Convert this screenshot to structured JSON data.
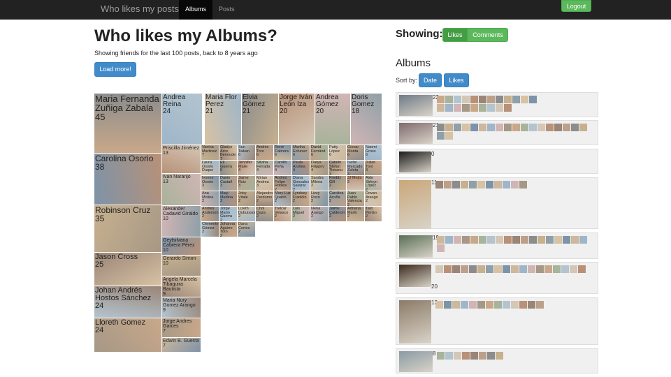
{
  "navbar": {
    "brand": "Who likes my posts?",
    "items": [
      {
        "label": "Albums",
        "active": true
      },
      {
        "label": "Posts",
        "active": false
      }
    ],
    "logout_label": "Logout"
  },
  "main": {
    "title": "Who likes my Albums?",
    "subtitle": "Showing friends for the last 100 posts, back to 8 years ago",
    "load_more_label": "Load more!"
  },
  "friends_mosaic": {
    "large": [
      {
        "name": "Maria Fernanda Zuñiga Zabala",
        "count": "45"
      },
      {
        "name": "Andrea Reina",
        "count": "24"
      },
      {
        "name": "Maria Flor Perez",
        "count": "21"
      },
      {
        "name": "Elvia Gómez",
        "count": "21"
      },
      {
        "name": "Jorge Iván León Iza",
        "count": "20"
      },
      {
        "name": "Andrea Gómez",
        "count": "20"
      },
      {
        "name": "Doris Gomez",
        "count": "18"
      },
      {
        "name": "Carolina Osorio",
        "count": "38"
      },
      {
        "name": "Robinson Cruz",
        "count": "35"
      },
      {
        "name": "Jason Cross",
        "count": "25"
      },
      {
        "name": "Johan Andrés Hostos Sánchez",
        "count": "24"
      },
      {
        "name": "Lloreth Gomez",
        "count": "24"
      }
    ],
    "medium": [
      {
        "name": "Priscilla Jiménez",
        "count": "13"
      },
      {
        "name": "Ivan Naranjo",
        "count": "13"
      },
      {
        "name": "Alexander Cadavid Giraldo",
        "count": "10"
      },
      {
        "name": "Geylsilvana Cabrera Pérez",
        "count": "10"
      },
      {
        "name": "Gerardo Simon",
        "count": "10"
      },
      {
        "name": "Angela Marcela Tibaquira Bautista",
        "count": "9"
      },
      {
        "name": "Maria Nury Gomez Arango",
        "count": "9"
      },
      {
        "name": "Jorge Andres Garces",
        "count": "7"
      },
      {
        "name": "Edwin B. Guerra",
        "count": "7"
      }
    ],
    "small": [
      {
        "name": "Vanina Martinez",
        "count": "7"
      },
      {
        "name": "Gladys Arce Bermude",
        "count": "7"
      },
      {
        "name": "Sun Taikan",
        "count": "6"
      },
      {
        "name": "Andrés Toro",
        "count": "6"
      },
      {
        "name": "René Cabrera",
        "count": "6"
      },
      {
        "name": "Martha Echever",
        "count": "6"
      },
      {
        "name": "David Fernánd",
        "count": "6"
      },
      {
        "name": "Patty López",
        "count": "6"
      },
      {
        "name": "Giovar Monta",
        "count": "6"
      },
      {
        "name": "Naomi Gross",
        "count": "6"
      },
      {
        "name": "Laura Osorio Duque",
        "count": ""
      },
      {
        "name": "Eli Guerra",
        "count": "5"
      },
      {
        "name": "Jennifer Maile",
        "count": "4"
      },
      {
        "name": "Silvina Ferrada",
        "count": "4"
      },
      {
        "name": "Carolin Peña",
        "count": "4"
      },
      {
        "name": "Paula Andrea",
        "count": "4"
      },
      {
        "name": "Darya Filippov",
        "count": "4"
      },
      {
        "name": "Catalin Stefan Tiseanu",
        "count": "3"
      },
      {
        "name": "Ivette Mercado Zuleta",
        "count": "3"
      },
      {
        "name": "Julian Toro",
        "count": "3"
      },
      {
        "name": "Ivonne Osorio",
        "count": "3"
      },
      {
        "name": "Danie Castañ",
        "count": "3"
      },
      {
        "name": "Jaime Ruiz",
        "count": "3"
      },
      {
        "name": "Mirian Andrea",
        "count": "3"
      },
      {
        "name": "Andres Felipe Robles",
        "count": "2"
      },
      {
        "name": "Diana Gonzalez Salazar",
        "count": "2"
      },
      {
        "name": "Sandra Milena",
        "count": "2"
      },
      {
        "name": "Freddy Gill",
        "count": "2"
      },
      {
        "name": "JJ Mejía",
        "count": "2"
      },
      {
        "name": "Aide Sirleyn López",
        "count": "2"
      },
      {
        "name": "Ana Molina",
        "count": "2"
      },
      {
        "name": "Mayi Medina",
        "count": "2"
      },
      {
        "name": "Joby Vitale",
        "count": "2"
      },
      {
        "name": "Alejandro Perdomo",
        "count": "2"
      },
      {
        "name": "Mary Luz Quarin",
        "count": "2"
      },
      {
        "name": "Lyndsey Franklin",
        "count": "2"
      },
      {
        "name": "Lizzy Rozo",
        "count": "2"
      },
      {
        "name": "Carolina Acuña",
        "count": "2"
      },
      {
        "name": "Juan Pablo Valencia",
        "count": "2"
      },
      {
        "name": "Dovan Arango",
        "count": "2"
      },
      {
        "name": "Andres Anderson",
        "count": "2"
      },
      {
        "name": "Jorge Mario Guerra",
        "count": "2"
      },
      {
        "name": "Lizeth Dubuisson",
        "count": "2"
      },
      {
        "name": "Chol Daza",
        "count": "2"
      },
      {
        "name": "Trelcar Velasco",
        "count": "2"
      },
      {
        "name": "Luis Miguel",
        "count": "2"
      },
      {
        "name": "Nena Arango",
        "count": "2"
      },
      {
        "name": "Jaime Calderon",
        "count": "2"
      },
      {
        "name": "Adriana Marín",
        "count": "2"
      },
      {
        "name": "Tato PerGo",
        "count": "2"
      },
      {
        "name": "Clemente Gómez",
        "count": "2"
      },
      {
        "name": "Johanna Aguirre Toro",
        "count": "2"
      },
      {
        "name": "Dana Cortes",
        "count": "2"
      }
    ]
  },
  "right": {
    "showing_label": "Showing:",
    "toggle": [
      {
        "label": "Likes",
        "active": true
      },
      {
        "label": "Comments",
        "active": false
      }
    ],
    "albums_heading": "Albums",
    "sort_label": "Sort by:",
    "sort_buttons": [
      {
        "label": "Date"
      },
      {
        "label": "Likes"
      }
    ],
    "albums": [
      {
        "count": "22",
        "likers": 21
      },
      {
        "count": "21",
        "likers": 20
      },
      {
        "count": "0",
        "likers": 0
      },
      {
        "count": "11",
        "likers": 11
      },
      {
        "count": "19",
        "likers": 19
      },
      {
        "count": "20",
        "likers": 18
      },
      {
        "count": "13",
        "likers": 13
      },
      {
        "count": "8",
        "likers": 8
      }
    ]
  },
  "colors": {
    "navbar": "#222222",
    "primary": "#428bca",
    "success": "#5cb85c",
    "album_bg": "#f0f0f0"
  }
}
